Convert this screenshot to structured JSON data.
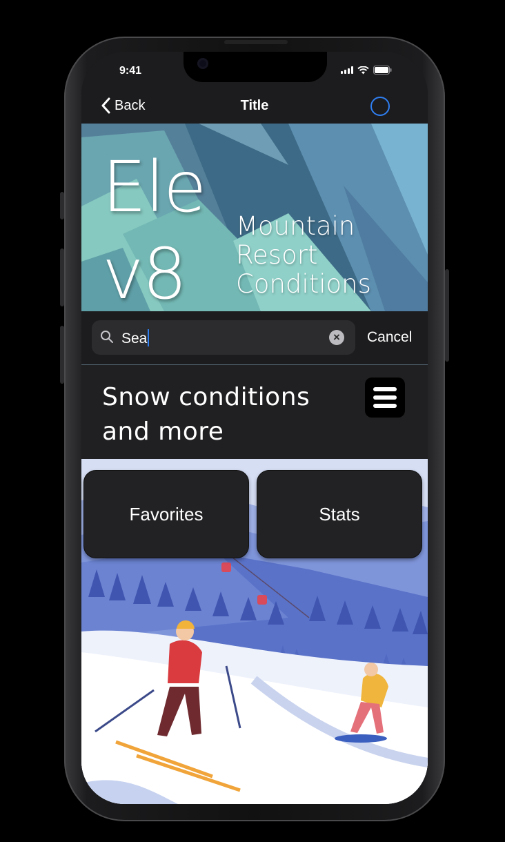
{
  "status_bar": {
    "time": "9:41"
  },
  "nav": {
    "back_label": "Back",
    "title": "Title"
  },
  "hero": {
    "brand_line1": "Ele",
    "brand_line2": "v8",
    "subtitle": [
      "Mountain",
      "Resort",
      "Conditions"
    ]
  },
  "search": {
    "value": "Sea",
    "cancel_label": "Cancel"
  },
  "section": {
    "title": "Snow conditions and more"
  },
  "tiles": [
    {
      "label": "Favorites"
    },
    {
      "label": "Stats"
    }
  ],
  "colors": {
    "accent": "#2f7ff2",
    "background": "#1c1c1e",
    "tile": "#222224"
  }
}
